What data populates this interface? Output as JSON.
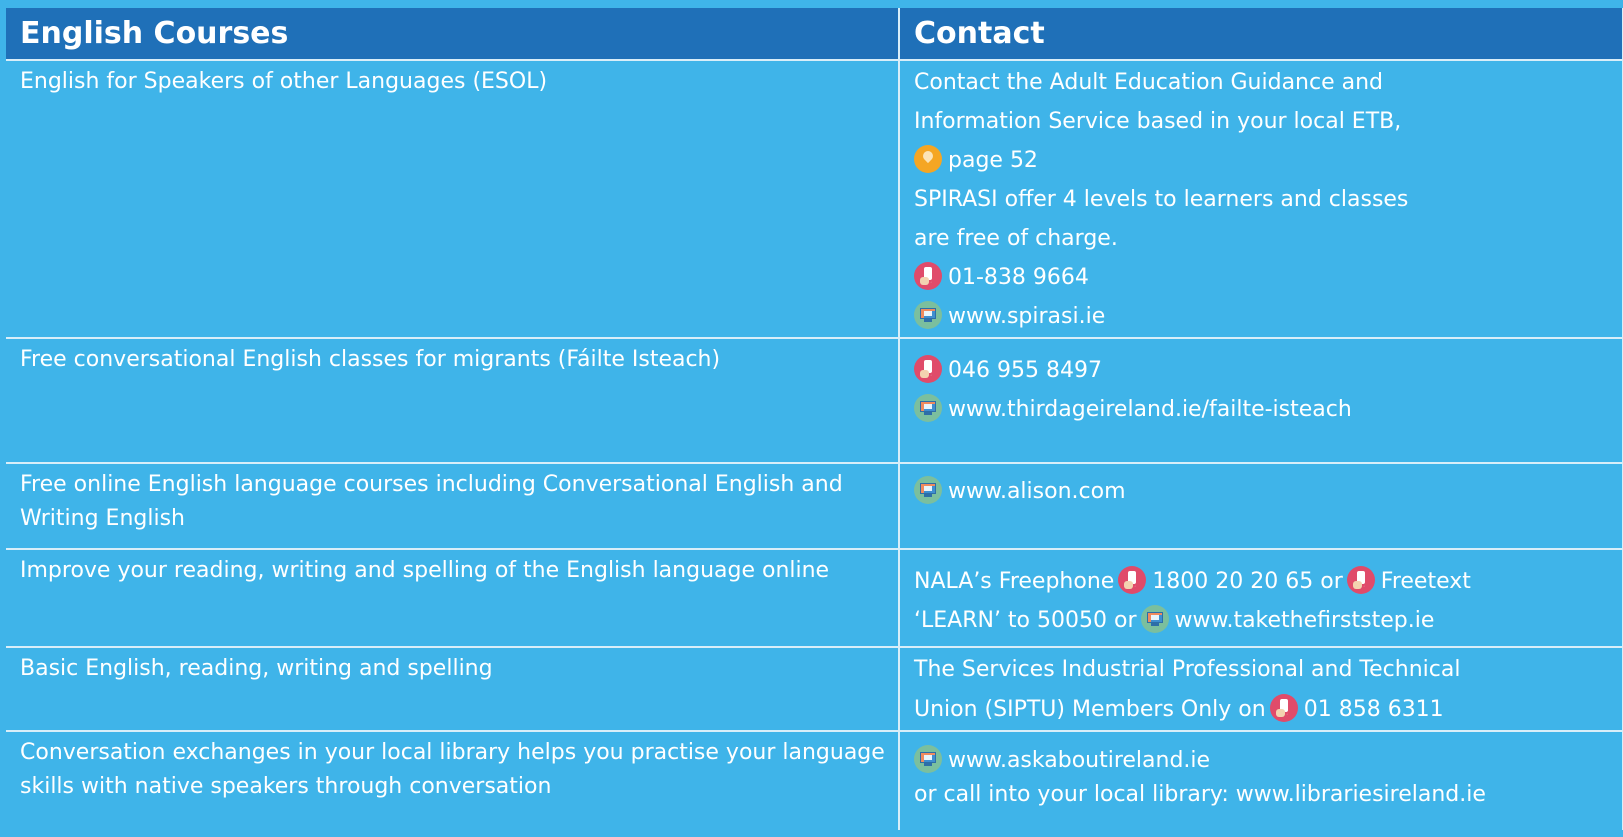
{
  "header": {
    "col1": "English Courses",
    "col2": "Contact"
  },
  "icons": {
    "pin": "location-pin-icon",
    "phone": "mobile-phone-icon",
    "web": "computer-monitor-icon"
  },
  "colors": {
    "header_bg": "#1f70b8",
    "row_bg": "#3fb4e9",
    "divider": "#d8eef9",
    "pin": "#f5a623",
    "phone": "#e04b6a",
    "web": "#7bbf9e"
  },
  "rows": [
    {
      "course": "English for Speakers of other Languages (ESOL)",
      "contact": {
        "l1": "Contact the Adult Education Guidance and",
        "l2": "Information Service based in your local ETB,",
        "l3": "page 52",
        "l4": "SPIRASI offer 4 levels to learners and classes",
        "l5": " are free of charge.",
        "l6": "01-838 9664",
        "l7": "www.spirasi.ie"
      }
    },
    {
      "course": "Free conversational English classes for migrants (Fáilte Isteach)",
      "contact": {
        "l1": "046 955 8497",
        "l2": "www.thirdageireland.ie/failte-isteach"
      }
    },
    {
      "course": "Free online English language courses including Conversational English and Writing English",
      "contact": {
        "l1": "www.alison.com"
      }
    },
    {
      "course": "Improve your reading, writing and spelling of the English language online",
      "contact": {
        "a": "NALA’s Freephone",
        "b": "1800 20 20 65 or",
        "c": "Freetext",
        "d": "‘LEARN’ to 50050 or",
        "e": "www.takethefirststep.ie"
      }
    },
    {
      "course": "Basic English, reading, writing and spelling",
      "contact": {
        "l1": "The Services Industrial Professional and Technical",
        "l2": "Union (SIPTU) Members Only on",
        "l3": "01 858 6311"
      }
    },
    {
      "course": "Conversation exchanges in your local library helps you practise your language skills with native speakers through conversation",
      "contact": {
        "l1": "www.askaboutireland.ie",
        "l2": "or call into your local library: www.librariesireland.ie"
      }
    }
  ]
}
